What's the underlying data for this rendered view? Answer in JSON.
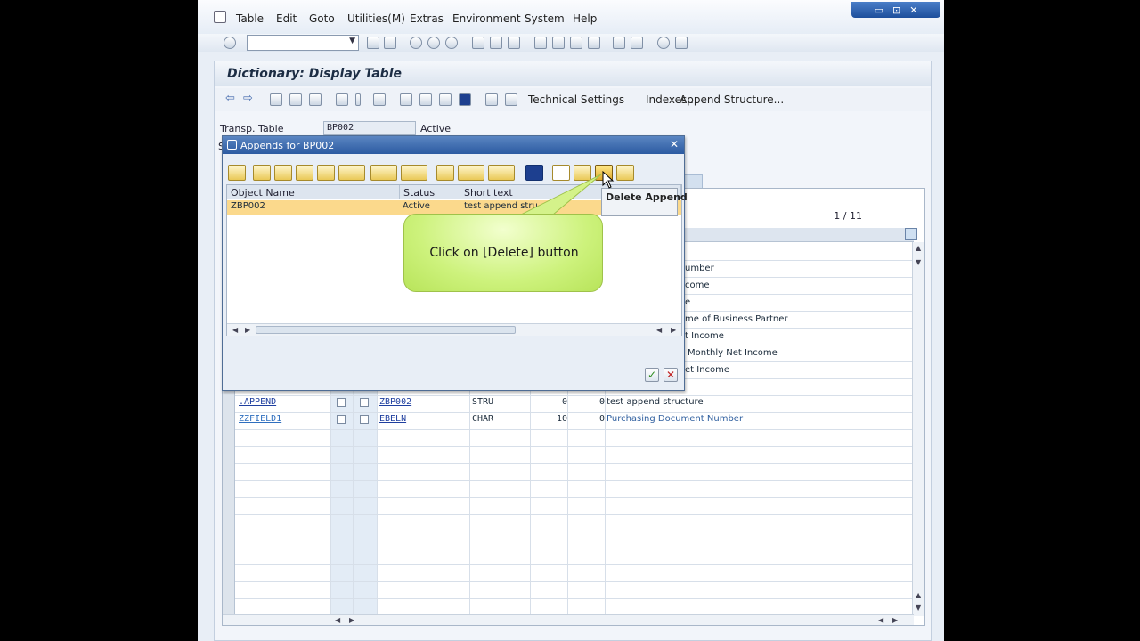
{
  "menubar": {
    "items": [
      "Table",
      "Edit",
      "Goto",
      "Utilities(M)",
      "Extras",
      "Environment",
      "System",
      "Help"
    ]
  },
  "window_controls": {
    "minimize": "▭",
    "maximize": "⊡",
    "close": "✕"
  },
  "screen": {
    "title": "Dictionary: Display Table",
    "toolbar": {
      "technical_settings": "Technical Settings",
      "indexes": "Indexes...",
      "append_structure": "Append Structure..."
    },
    "transp_table_label": "Transp. Table",
    "transp_table_value": "BP002",
    "status_value": "Active",
    "partial_label_s": "S",
    "partial_tab_label": "ls"
  },
  "grid": {
    "counter": "1  /  11",
    "partial_descriptions": [
      "umber",
      "come",
      "e",
      "me of Business Partner",
      "t Income",
      "Monthly Net Income",
      "et Income"
    ],
    "rows": [
      {
        "field": ".APPEND",
        "data_element": "ZBP002",
        "type": "STRU",
        "length": "0",
        "decimals": "0",
        "description": "test append structure"
      },
      {
        "field": "ZZFIELD1",
        "data_element": "EBELN",
        "type": "CHAR",
        "length": "10",
        "decimals": "0",
        "description": "Purchasing Document Number"
      }
    ]
  },
  "dialog": {
    "title": "Appends for BP002",
    "close": "✕",
    "columns": [
      "Object Name",
      "Status",
      "Short text"
    ],
    "row": {
      "object_name": "ZBP002",
      "status": "Active",
      "short_text": "test append stru"
    },
    "ok_label": "✓",
    "cancel_label": "✕"
  },
  "tooltip": {
    "text": "Delete Append"
  },
  "callout": {
    "text": "Click on [Delete] button"
  },
  "colors": {
    "title_bar": "#2b5aa1",
    "selected_row": "#fbd98c",
    "callout": "#cdf27c",
    "link": "#1f3f9f"
  }
}
